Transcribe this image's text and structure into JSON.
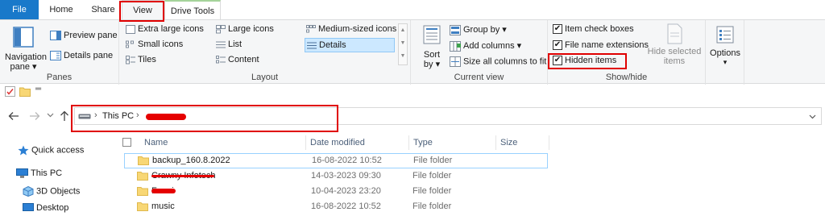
{
  "tabs": {
    "file": "File",
    "home": "Home",
    "share": "Share",
    "view": "View",
    "drive_tools": "Drive Tools"
  },
  "ribbon": {
    "panes": {
      "navigation_pane": [
        "Navigation",
        "pane ▾"
      ],
      "preview_pane": "Preview pane",
      "details_pane": "Details pane",
      "label": "Panes"
    },
    "layout": {
      "options": [
        "Extra large icons",
        "Large icons",
        "Medium-sized icons",
        "Small icons",
        "List",
        "Details",
        "Tiles",
        "Content"
      ],
      "selected": "Details",
      "label": "Layout"
    },
    "current_view": {
      "sort_by": [
        "Sort",
        "by ▾"
      ],
      "group_by": "Group by ▾",
      "add_columns": "Add columns ▾",
      "size_all_columns": "Size all columns to fit",
      "label": "Current view"
    },
    "show_hide": {
      "item_check_boxes": "Item check boxes",
      "file_name_extensions": "File name extensions",
      "hidden_items": "Hidden items",
      "hide_selected_items": [
        "Hide selected",
        "items"
      ],
      "label": "Show/hide",
      "checks": {
        "item_check_boxes": true,
        "file_name_extensions": true,
        "hidden_items": true
      }
    },
    "options": {
      "label": "Options",
      "arrow": "▾"
    }
  },
  "address": {
    "this_pc": "This PC",
    "chevron": "›"
  },
  "nav_pane": {
    "items": [
      "Quick access",
      "This PC",
      "3D Objects",
      "Desktop"
    ]
  },
  "columns": [
    "Name",
    "Date modified",
    "Type",
    "Size"
  ],
  "files": [
    {
      "name": "backup_160.8.2022",
      "date": "16-08-2022 10:52",
      "type": "File folder"
    },
    {
      "name": "Crawny Infotech",
      "date": "14-03-2023 09:30",
      "type": "File folder"
    },
    {
      "name": "Fanni",
      "date": "10-04-2023 23:20",
      "type": "File folder"
    },
    {
      "name": "music",
      "date": "16-08-2022 10:52",
      "type": "File folder"
    }
  ],
  "colors": {
    "accent": "#1979ca",
    "folder": "#f8d775",
    "annotation": "#e00000",
    "selection_border": "#99d1ff"
  }
}
